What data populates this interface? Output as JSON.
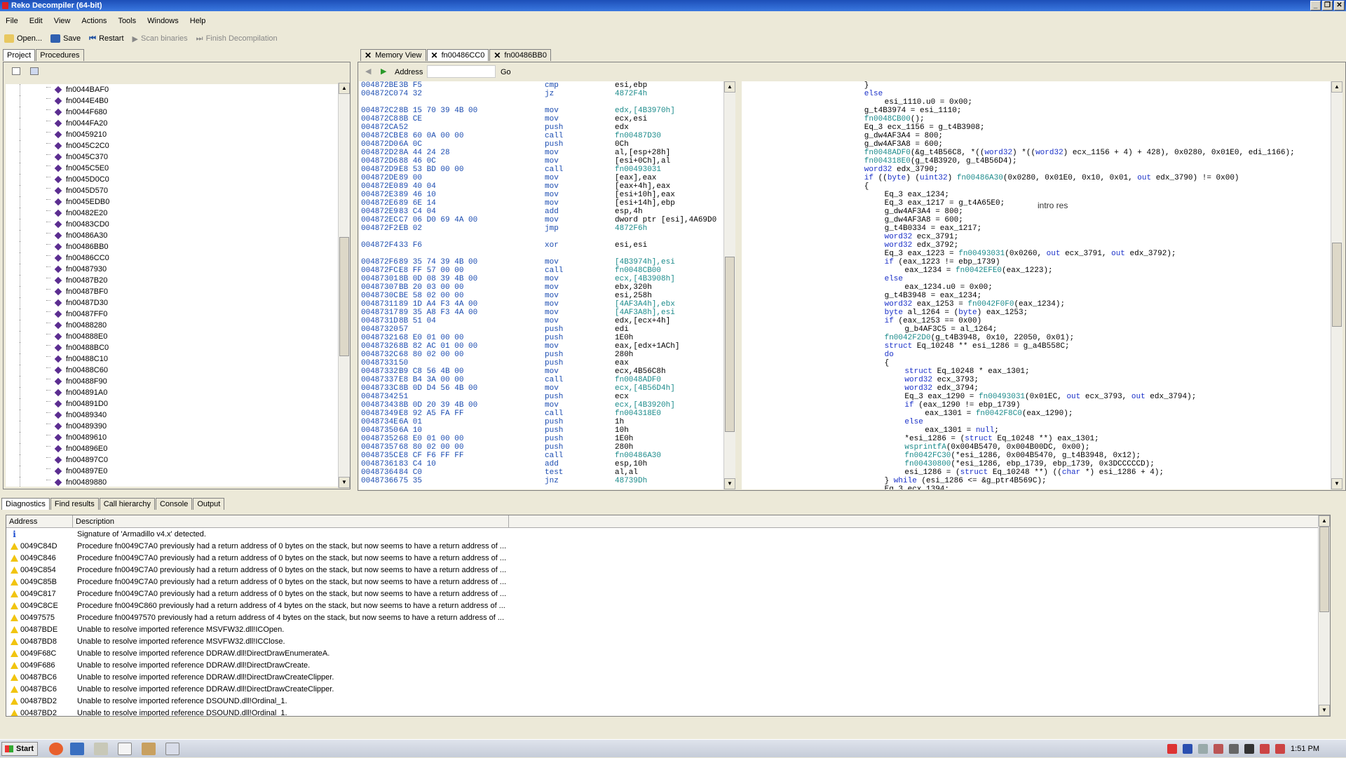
{
  "window": {
    "title": "Reko Decompiler (64-bit)"
  },
  "menu": [
    "File",
    "Edit",
    "View",
    "Actions",
    "Tools",
    "Windows",
    "Help"
  ],
  "toolbar": {
    "open": "Open...",
    "save": "Save",
    "restart": "Restart",
    "scan": "Scan binaries",
    "finish": "Finish Decompilation"
  },
  "left_tabs": [
    "Project",
    "Procedures"
  ],
  "tree_items": [
    "fn0044BAF0",
    "fn0044E4B0",
    "fn0044F680",
    "fn0044FA20",
    "fn00459210",
    "fn0045C2C0",
    "fn0045C370",
    "fn0045C5E0",
    "fn0045D0C0",
    "fn0045D570",
    "fn0045EDB0",
    "fn00482E20",
    "fn00483CD0",
    "fn00486A30",
    "fn00486BB0",
    "fn00486CC0",
    "fn00487930",
    "fn00487B20",
    "fn00487BF0",
    "fn00487D30",
    "fn00487FF0",
    "fn00488280",
    "fn004888E0",
    "fn00488BC0",
    "fn00488C10",
    "fn00488C60",
    "fn00488F90",
    "fn004891A0",
    "fn004891D0",
    "fn00489340",
    "fn00489390",
    "fn00489610",
    "fn004896E0",
    "fn004897C0",
    "fn004897E0",
    "fn00489880"
  ],
  "doc_tabs": [
    "Memory View",
    "fn00486CC0",
    "fn00486BB0"
  ],
  "address_bar": {
    "label": "Address",
    "go": "Go"
  },
  "asm": [
    [
      "004872BE",
      "3B F5",
      "cmp",
      "esi,ebp",
      false
    ],
    [
      "004872C0",
      "74 32",
      "jz",
      "4872F4h",
      true
    ],
    [
      "",
      "",
      "",
      "",
      false
    ],
    [
      "004872C2",
      "8B 15 70 39 4B 00",
      "mov",
      "edx,[4B3970h]",
      true
    ],
    [
      "004872C8",
      "8B CE",
      "mov",
      "ecx,esi",
      false
    ],
    [
      "004872CA",
      "52",
      "push",
      "edx",
      false
    ],
    [
      "004872CB",
      "E8 60 0A 00 00",
      "call",
      "fn00487D30",
      true
    ],
    [
      "004872D0",
      "6A 0C",
      "push",
      "0Ch",
      false
    ],
    [
      "004872D2",
      "8A 44 24 28",
      "mov",
      "al,[esp+28h]",
      false
    ],
    [
      "004872D6",
      "88 46 0C",
      "mov",
      "[esi+0Ch],al",
      false
    ],
    [
      "004872D9",
      "E8 53 BD 00 00",
      "call",
      "fn00493031",
      true
    ],
    [
      "004872DE",
      "89 00",
      "mov",
      "[eax],eax",
      false
    ],
    [
      "004872E0",
      "89 40 04",
      "mov",
      "[eax+4h],eax",
      false
    ],
    [
      "004872E3",
      "89 46 10",
      "mov",
      "[esi+10h],eax",
      false
    ],
    [
      "004872E6",
      "89 6E 14",
      "mov",
      "[esi+14h],ebp",
      false
    ],
    [
      "004872E9",
      "83 C4 04",
      "add",
      "esp,4h",
      false
    ],
    [
      "004872EC",
      "C7 06 D0 69 4A 00",
      "mov",
      "dword ptr [esi],4A69D0",
      false
    ],
    [
      "004872F2",
      "EB 02",
      "jmp",
      "4872F6h",
      true
    ],
    [
      "",
      "",
      "",
      "",
      false
    ],
    [
      "004872F4",
      "33 F6",
      "xor",
      "esi,esi",
      false
    ],
    [
      "",
      "",
      "",
      "",
      false
    ],
    [
      "004872F6",
      "89 35 74 39 4B 00",
      "mov",
      "[4B3974h],esi",
      true
    ],
    [
      "004872FC",
      "E8 FF 57 00 00",
      "call",
      "fn0048CB00",
      true
    ],
    [
      "00487301",
      "8B 0D 08 39 4B 00",
      "mov",
      "ecx,[4B3908h]",
      true
    ],
    [
      "00487307",
      "BB 20 03 00 00",
      "mov",
      "ebx,320h",
      false
    ],
    [
      "0048730C",
      "BE 58 02 00 00",
      "mov",
      "esi,258h",
      false
    ],
    [
      "00487311",
      "89 1D A4 F3 4A 00",
      "mov",
      "[4AF3A4h],ebx",
      true
    ],
    [
      "00487317",
      "89 35 A8 F3 4A 00",
      "mov",
      "[4AF3A8h],esi",
      true
    ],
    [
      "0048731D",
      "8B 51 04",
      "mov",
      "edx,[ecx+4h]",
      false
    ],
    [
      "00487320",
      "57",
      "push",
      "edi",
      false
    ],
    [
      "00487321",
      "68 E0 01 00 00",
      "push",
      "1E0h",
      false
    ],
    [
      "00487326",
      "8B 82 AC 01 00 00",
      "mov",
      "eax,[edx+1ACh]",
      false
    ],
    [
      "0048732C",
      "68 80 02 00 00",
      "push",
      "280h",
      false
    ],
    [
      "00487331",
      "50",
      "push",
      "eax",
      false
    ],
    [
      "00487332",
      "B9 C8 56 4B 00",
      "mov",
      "ecx,4B56C8h",
      false
    ],
    [
      "00487337",
      "E8 B4 3A 00 00",
      "call",
      "fn0048ADF0",
      true
    ],
    [
      "0048733C",
      "8B 0D D4 56 4B 00",
      "mov",
      "ecx,[4B56D4h]",
      true
    ],
    [
      "00487342",
      "51",
      "push",
      "ecx",
      false
    ],
    [
      "00487343",
      "8B 0D 20 39 4B 00",
      "mov",
      "ecx,[4B3920h]",
      true
    ],
    [
      "00487349",
      "E8 92 A5 FA FF",
      "call",
      "fn004318E0",
      true
    ],
    [
      "0048734E",
      "6A 01",
      "push",
      "1h",
      false
    ],
    [
      "00487350",
      "6A 10",
      "push",
      "10h",
      false
    ],
    [
      "00487352",
      "68 E0 01 00 00",
      "push",
      "1E0h",
      false
    ],
    [
      "00487357",
      "68 80 02 00 00",
      "push",
      "280h",
      false
    ],
    [
      "0048735C",
      "E8 CF F6 FF FF",
      "call",
      "fn00486A30",
      true
    ],
    [
      "00487361",
      "83 C4 10",
      "add",
      "esp,10h",
      false
    ],
    [
      "00487364",
      "84 C0",
      "test",
      "al,al",
      false
    ],
    [
      "00487366",
      "75 35",
      "jnz",
      "48739Dh",
      true
    ]
  ],
  "code": [
    [
      [
        24,
        ""
      ],
      [
        0,
        "}"
      ]
    ],
    [
      [
        24,
        ""
      ],
      [
        1,
        "else"
      ]
    ],
    [
      [
        28,
        ""
      ],
      [
        0,
        "esi_1110.u0 = 0x00;"
      ]
    ],
    [
      [
        24,
        ""
      ],
      [
        0,
        "g_t4B3974 = esi_1110;"
      ]
    ],
    [
      [
        24,
        ""
      ],
      [
        2,
        "fn0048CB00"
      ],
      [
        0,
        "();"
      ]
    ],
    [
      [
        24,
        ""
      ],
      [
        0,
        "Eq_3 ecx_1156 = g_t4B3908;"
      ]
    ],
    [
      [
        24,
        ""
      ],
      [
        0,
        "g_dw4AF3A4 = 800;"
      ]
    ],
    [
      [
        24,
        ""
      ],
      [
        0,
        "g_dw4AF3A8 = 600;"
      ]
    ],
    [
      [
        24,
        ""
      ],
      [
        2,
        "fn0048ADF0"
      ],
      [
        0,
        "(&g_t4B56C8, *(("
      ],
      [
        1,
        "word32"
      ],
      [
        0,
        ") *(("
      ],
      [
        1,
        "word32"
      ],
      [
        0,
        ") ecx_1156 + 4) + 428), 0x0280, 0x01E0, edi_1166);"
      ]
    ],
    [
      [
        24,
        ""
      ],
      [
        2,
        "fn004318E0"
      ],
      [
        0,
        "(g_t4B3920, g_t4B56D4);"
      ]
    ],
    [
      [
        24,
        ""
      ],
      [
        1,
        "word32"
      ],
      [
        0,
        " edx_3790;"
      ]
    ],
    [
      [
        24,
        ""
      ],
      [
        1,
        "if"
      ],
      [
        0,
        " (("
      ],
      [
        1,
        "byte"
      ],
      [
        0,
        ") ("
      ],
      [
        1,
        "uint32"
      ],
      [
        0,
        ") "
      ],
      [
        2,
        "fn00486A30"
      ],
      [
        0,
        "(0x0280, 0x01E0, 0x10, 0x01, "
      ],
      [
        1,
        "out"
      ],
      [
        0,
        " edx_3790) != 0x00)"
      ]
    ],
    [
      [
        24,
        ""
      ],
      [
        0,
        "{"
      ]
    ],
    [
      [
        28,
        ""
      ],
      [
        0,
        "Eq_3 eax_1234;"
      ]
    ],
    [
      [
        28,
        ""
      ],
      [
        0,
        "Eq_3 eax_1217 = g_t4A65E0;"
      ]
    ],
    [
      [
        28,
        ""
      ],
      [
        0,
        "g_dw4AF3A4 = 800;"
      ]
    ],
    [
      [
        28,
        ""
      ],
      [
        0,
        "g_dw4AF3A8 = 600;"
      ]
    ],
    [
      [
        28,
        ""
      ],
      [
        0,
        "g_t4B0334 = eax_1217;"
      ]
    ],
    [
      [
        28,
        ""
      ],
      [
        1,
        "word32"
      ],
      [
        0,
        " ecx_3791;"
      ]
    ],
    [
      [
        28,
        ""
      ],
      [
        1,
        "word32"
      ],
      [
        0,
        " edx_3792;"
      ]
    ],
    [
      [
        28,
        ""
      ],
      [
        0,
        "Eq_3 eax_1223 = "
      ],
      [
        2,
        "fn00493031"
      ],
      [
        0,
        "(0x0260, "
      ],
      [
        1,
        "out"
      ],
      [
        0,
        " ecx_3791, "
      ],
      [
        1,
        "out"
      ],
      [
        0,
        " edx_3792);"
      ]
    ],
    [
      [
        28,
        ""
      ],
      [
        1,
        "if"
      ],
      [
        0,
        " (eax_1223 != ebp_1739)"
      ]
    ],
    [
      [
        32,
        ""
      ],
      [
        0,
        "eax_1234 = "
      ],
      [
        2,
        "fn0042EFE0"
      ],
      [
        0,
        "(eax_1223);"
      ]
    ],
    [
      [
        28,
        ""
      ],
      [
        1,
        "else"
      ]
    ],
    [
      [
        32,
        ""
      ],
      [
        0,
        "eax_1234.u0 = 0x00;"
      ]
    ],
    [
      [
        28,
        ""
      ],
      [
        0,
        "g_t4B3948 = eax_1234;"
      ]
    ],
    [
      [
        28,
        ""
      ],
      [
        1,
        "word32"
      ],
      [
        0,
        " eax_1253 = "
      ],
      [
        2,
        "fn0042F0F0"
      ],
      [
        0,
        "(eax_1234);"
      ]
    ],
    [
      [
        28,
        ""
      ],
      [
        1,
        "byte"
      ],
      [
        0,
        " al_1264 = ("
      ],
      [
        1,
        "byte"
      ],
      [
        0,
        ") eax_1253;"
      ]
    ],
    [
      [
        28,
        ""
      ],
      [
        1,
        "if"
      ],
      [
        0,
        " (eax_1253 == 0x00)"
      ]
    ],
    [
      [
        32,
        ""
      ],
      [
        0,
        "g_b4AF3C5 = al_1264;"
      ]
    ],
    [
      [
        28,
        ""
      ],
      [
        2,
        "fn0042F2D0"
      ],
      [
        0,
        "(g_t4B3948, 0x10, 22050, 0x01);"
      ]
    ],
    [
      [
        28,
        ""
      ],
      [
        1,
        "struct"
      ],
      [
        0,
        " Eq_10248 ** esi_1286 = g_a4B558C;"
      ]
    ],
    [
      [
        28,
        ""
      ],
      [
        1,
        "do"
      ]
    ],
    [
      [
        28,
        ""
      ],
      [
        0,
        "{"
      ]
    ],
    [
      [
        32,
        ""
      ],
      [
        1,
        "struct"
      ],
      [
        0,
        " Eq_10248 * eax_1301;"
      ]
    ],
    [
      [
        32,
        ""
      ],
      [
        1,
        "word32"
      ],
      [
        0,
        " ecx_3793;"
      ]
    ],
    [
      [
        32,
        ""
      ],
      [
        1,
        "word32"
      ],
      [
        0,
        " edx_3794;"
      ]
    ],
    [
      [
        32,
        ""
      ],
      [
        0,
        "Eq_3 eax_1290 = "
      ],
      [
        2,
        "fn00493031"
      ],
      [
        0,
        "(0x01EC, "
      ],
      [
        1,
        "out"
      ],
      [
        0,
        " ecx_3793, "
      ],
      [
        1,
        "out"
      ],
      [
        0,
        " edx_3794);"
      ]
    ],
    [
      [
        32,
        ""
      ],
      [
        1,
        "if"
      ],
      [
        0,
        " (eax_1290 != ebp_1739)"
      ]
    ],
    [
      [
        36,
        ""
      ],
      [
        0,
        "eax_1301 = "
      ],
      [
        2,
        "fn0042F8C0"
      ],
      [
        0,
        "(eax_1290);"
      ]
    ],
    [
      [
        32,
        ""
      ],
      [
        1,
        "else"
      ]
    ],
    [
      [
        36,
        ""
      ],
      [
        0,
        "eax_1301 = "
      ],
      [
        1,
        "null"
      ],
      [
        0,
        ";"
      ]
    ],
    [
      [
        32,
        ""
      ],
      [
        0,
        "*esi_1286 = ("
      ],
      [
        1,
        "struct"
      ],
      [
        0,
        " Eq_10248 **) eax_1301;"
      ]
    ],
    [
      [
        32,
        ""
      ],
      [
        2,
        "wsprintfA"
      ],
      [
        0,
        "(0x004B5470, 0x004B00DC, 0x00);"
      ]
    ],
    [
      [
        32,
        ""
      ],
      [
        2,
        "fn0042FC30"
      ],
      [
        0,
        "(*esi_1286, 0x004B5470, g_t4B3948, 0x12);"
      ]
    ],
    [
      [
        32,
        ""
      ],
      [
        2,
        "fn00430800"
      ],
      [
        0,
        "(*esi_1286, ebp_1739, ebp_1739, 0x3DCCCCCD);"
      ]
    ],
    [
      [
        32,
        ""
      ],
      [
        0,
        "esi_1286 = ("
      ],
      [
        1,
        "struct"
      ],
      [
        0,
        " Eq_10248 **) (("
      ],
      [
        1,
        "char"
      ],
      [
        0,
        " *) esi_1286 + 4);"
      ]
    ],
    [
      [
        28,
        ""
      ],
      [
        0,
        "} "
      ],
      [
        1,
        "while"
      ],
      [
        0,
        " (esi_1286 <= &g_ptr4B569C);"
      ]
    ],
    [
      [
        28,
        ""
      ],
      [
        0,
        "Eq_3 ecx_1394;"
      ]
    ]
  ],
  "annotation": "intro res",
  "bottom_tabs": [
    "Diagnostics",
    "Find results",
    "Call hierarchy",
    "Console",
    "Output"
  ],
  "diag_headers": {
    "address": "Address",
    "description": "Description"
  },
  "diagnostics": [
    {
      "type": "info",
      "address": "",
      "description": "Signature of 'Armadillo v4.x' detected."
    },
    {
      "type": "warn",
      "address": "0049C84D",
      "description": "Procedure fn0049C7A0 previously had a return address of 0 bytes on the stack, but now seems to have a return address of ..."
    },
    {
      "type": "warn",
      "address": "0049C846",
      "description": "Procedure fn0049C7A0 previously had a return address of 0 bytes on the stack, but now seems to have a return address of ..."
    },
    {
      "type": "warn",
      "address": "0049C854",
      "description": "Procedure fn0049C7A0 previously had a return address of 0 bytes on the stack, but now seems to have a return address of ..."
    },
    {
      "type": "warn",
      "address": "0049C85B",
      "description": "Procedure fn0049C7A0 previously had a return address of 0 bytes on the stack, but now seems to have a return address of ..."
    },
    {
      "type": "warn",
      "address": "0049C817",
      "description": "Procedure fn0049C7A0 previously had a return address of 0 bytes on the stack, but now seems to have a return address of ..."
    },
    {
      "type": "warn",
      "address": "0049C8CE",
      "description": "Procedure fn0049C860 previously had a return address of 4 bytes on the stack, but now seems to have a return address of ..."
    },
    {
      "type": "warn",
      "address": "00497575",
      "description": "Procedure fn00497570 previously had a return address of 4 bytes on the stack, but now seems to have a return address of ..."
    },
    {
      "type": "warn",
      "address": "00487BDE",
      "description": "Unable to resolve imported reference MSVFW32.dll!ICOpen."
    },
    {
      "type": "warn",
      "address": "00487BD8",
      "description": "Unable to resolve imported reference MSVFW32.dll!ICClose."
    },
    {
      "type": "warn",
      "address": "0049F68C",
      "description": "Unable to resolve imported reference DDRAW.dll!DirectDrawEnumerateA."
    },
    {
      "type": "warn",
      "address": "0049F686",
      "description": "Unable to resolve imported reference DDRAW.dll!DirectDrawCreate."
    },
    {
      "type": "warn",
      "address": "00487BC6",
      "description": "Unable to resolve imported reference DDRAW.dll!DirectDrawCreateClipper."
    },
    {
      "type": "warn",
      "address": "00487BC6",
      "description": "Unable to resolve imported reference DDRAW.dll!DirectDrawCreateClipper."
    },
    {
      "type": "warn",
      "address": "00487BD2",
      "description": "Unable to resolve imported reference DSOUND.dll!Ordinal_1."
    },
    {
      "type": "warn",
      "address": "00487BD2",
      "description": "Unable to resolve imported reference DSOUND.dll!Ordinal_1."
    }
  ],
  "taskbar": {
    "start": "Start",
    "clock": "1:51 PM"
  },
  "colors": {
    "titlebar": "#2a64d0",
    "link": "#1a8a8a",
    "keyword": "#1a30c8",
    "asm_blue": "#1a4bb0"
  }
}
